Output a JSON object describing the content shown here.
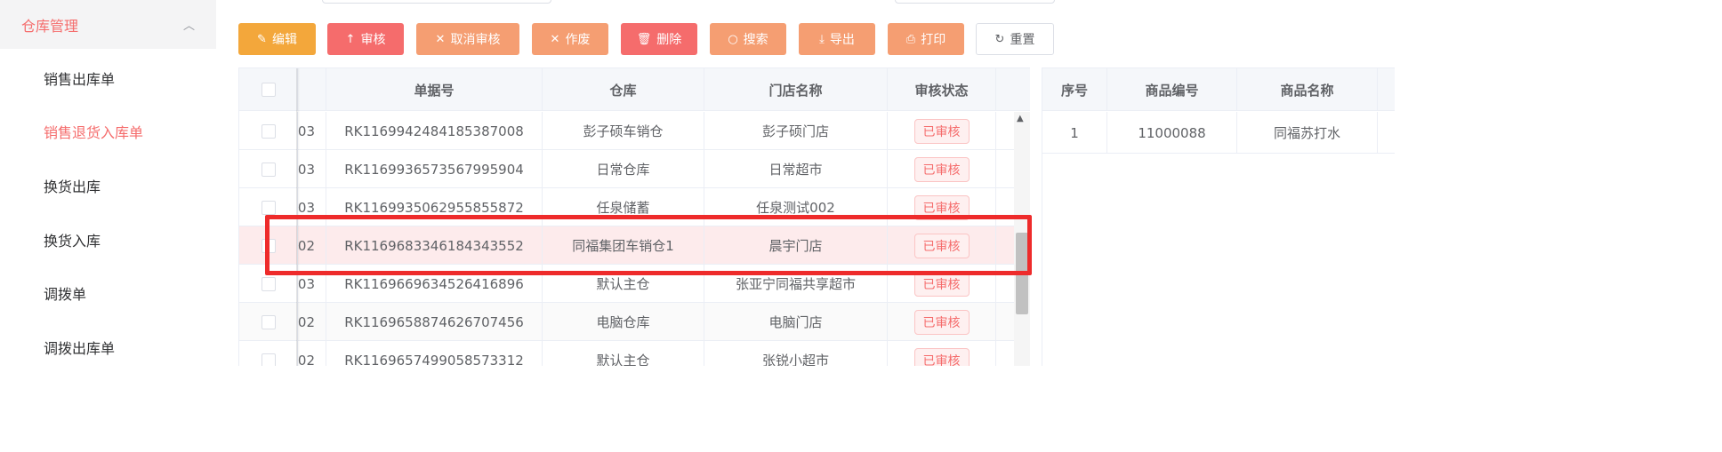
{
  "sidebar": {
    "group_label": "仓库管理",
    "group_chevron": "chevron-up-icon",
    "items": [
      {
        "label": "销售出库单",
        "active": false
      },
      {
        "label": "销售退货入库单",
        "active": true
      },
      {
        "label": "换货出库",
        "active": false
      },
      {
        "label": "换货入库",
        "active": false
      },
      {
        "label": "调拨单",
        "active": false
      },
      {
        "label": "调拨出库单",
        "active": false
      }
    ]
  },
  "toolbar": {
    "edit": {
      "label": "编辑",
      "icon": "✎"
    },
    "audit": {
      "label": "审核",
      "icon": "↑"
    },
    "cancel_audit": {
      "label": "取消审核",
      "icon": "✕"
    },
    "void": {
      "label": "作废",
      "icon": "✕"
    },
    "delete": {
      "label": "删除",
      "icon": "🗑"
    },
    "search": {
      "label": "搜索",
      "icon": "○"
    },
    "export": {
      "label": "导出",
      "icon": "⤓"
    },
    "print": {
      "label": "打印",
      "icon": "⎙"
    },
    "reset": {
      "label": "重置",
      "icon": "↻"
    }
  },
  "main_table": {
    "headers": {
      "doc_no": "单据号",
      "warehouse": "仓库",
      "store": "门店名称",
      "status": "审核状态"
    },
    "rows": [
      {
        "prefix": "03",
        "doc_no": "RK1169942484185387008",
        "warehouse": "彭子硕车销仓",
        "store": "彭子硕门店",
        "status": "已审核"
      },
      {
        "prefix": "03",
        "doc_no": "RK1169936573567995904",
        "warehouse": "日常仓库",
        "store": "日常超市",
        "status": "已审核"
      },
      {
        "prefix": "03",
        "doc_no": "RK1169935062955855872",
        "warehouse": "任泉储蓄",
        "store": "任泉测试002",
        "status": "已审核"
      },
      {
        "prefix": "02",
        "doc_no": "RK1169683346184343552",
        "warehouse": "同福集团车销仓1",
        "store": "晨宇门店",
        "status": "已审核"
      },
      {
        "prefix": "03",
        "doc_no": "RK1169669634526416896",
        "warehouse": "默认主仓",
        "store": "张亚宁同福共享超市",
        "status": "已审核"
      },
      {
        "prefix": "02",
        "doc_no": "RK1169658874626707456",
        "warehouse": "电脑仓库",
        "store": "电脑门店",
        "status": "已审核"
      },
      {
        "prefix": "02",
        "doc_no": "RK1169657499058573312",
        "warehouse": "默认主仓",
        "store": "张锐小超市",
        "status": "已审核"
      }
    ]
  },
  "detail_table": {
    "headers": {
      "seq": "序号",
      "code": "商品编号",
      "name": "商品名称"
    },
    "rows": [
      {
        "seq": "1",
        "code": "11000088",
        "name": "同福苏打水"
      }
    ]
  },
  "colors": {
    "accent": "#f56c6c",
    "edit": "#f3a73b",
    "highlight_box": "#ee2b2b"
  }
}
